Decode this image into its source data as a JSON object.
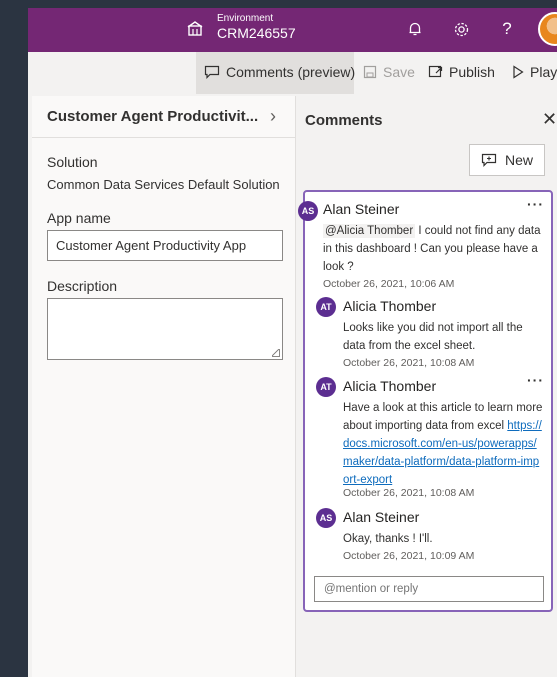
{
  "topbar": {
    "environment_label": "Environment",
    "environment_name": "CRM246557",
    "icons": [
      "environment-icon",
      "bell-icon",
      "gear-icon",
      "help-icon",
      "avatar"
    ]
  },
  "commandbar": {
    "comments_label": "Comments (preview)",
    "save_label": "Save",
    "publish_label": "Publish",
    "play_label": "Play"
  },
  "app_panel": {
    "title": "Customer Agent Productivit...",
    "solution_label": "Solution",
    "solution_value": "Common Data Services Default Solution",
    "app_name_label": "App name",
    "app_name_value": "Customer Agent Productivity App",
    "description_label": "Description",
    "description_value": ""
  },
  "comments": {
    "title": "Comments",
    "new_label": "New",
    "reply_placeholder": "@mention or reply",
    "thread": [
      {
        "initials": "AS",
        "author": "Alan Steiner",
        "mention": "@Alicia Thomber",
        "text": " I could not find any data in this dashboard ! Can you please have a look ?",
        "timestamp": "October 26, 2021, 10:06 AM"
      },
      {
        "initials": "AT",
        "author": "Alicia Thomber",
        "text": "Looks like you did not import all the data from the excel sheet.",
        "timestamp": "October 26, 2021, 10:08 AM"
      },
      {
        "initials": "AT",
        "author": "Alicia Thomber",
        "text": "Have a look at this article to learn more about importing data from excel ",
        "link": "https://docs.microsoft.com/en-us/powerapps/maker/data-platform/data-platform-import-export",
        "timestamp": "October 26, 2021, 10:08 AM"
      },
      {
        "initials": "AS",
        "author": "Alan Steiner",
        "text": "Okay, thanks ! I'll.",
        "timestamp": "October 26, 2021, 10:09 AM"
      }
    ]
  },
  "colors": {
    "topbar": "#742774",
    "avatar": "#5c2e91",
    "thread_border": "#8764b8",
    "link": "#0f6cbd"
  }
}
